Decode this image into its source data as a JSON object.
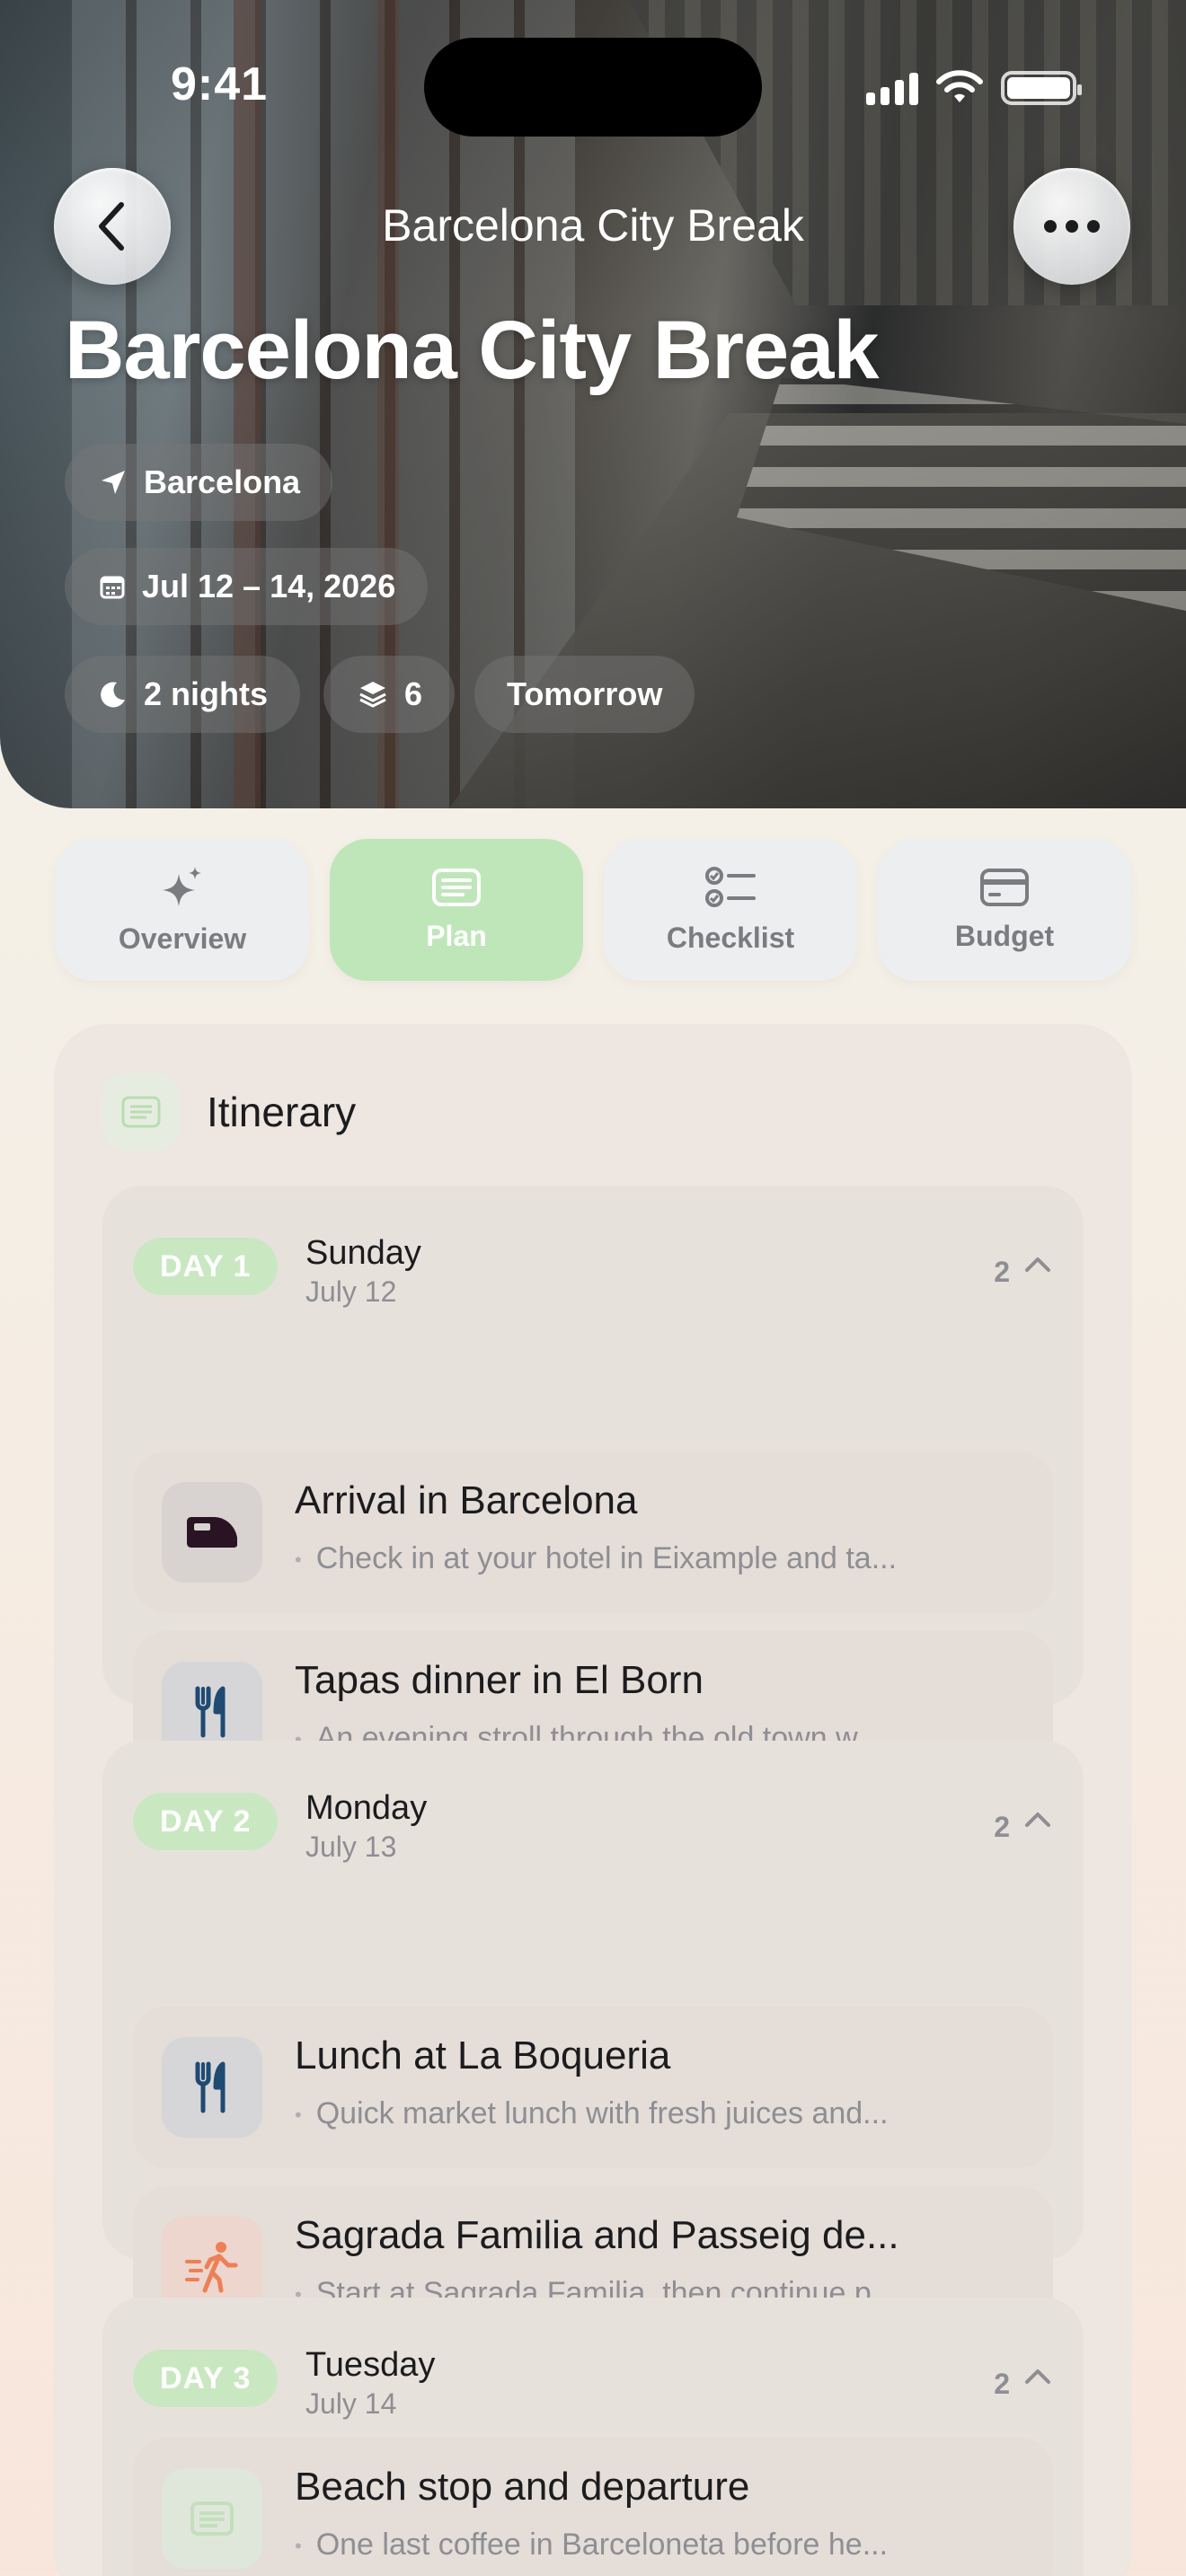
{
  "status_bar": {
    "time": "9:41"
  },
  "nav": {
    "title": "Barcelona City Break"
  },
  "hero": {
    "title": "Barcelona City Break",
    "location": "Barcelona",
    "dates": "Jul 12 – 14, 2026",
    "nights": "2 nights",
    "stops": "6",
    "when": "Tomorrow"
  },
  "tabs": [
    {
      "label": "Overview",
      "icon": "sparkles-icon",
      "active": false
    },
    {
      "label": "Plan",
      "icon": "list-card-icon",
      "active": true
    },
    {
      "label": "Checklist",
      "icon": "checklist-icon",
      "active": false
    },
    {
      "label": "Budget",
      "icon": "credit-card-icon",
      "active": false
    }
  ],
  "itinerary": {
    "title": "Itinerary",
    "days": [
      {
        "badge": "DAY 1",
        "weekday": "Sunday",
        "date": "July 12",
        "count": "2",
        "activities": [
          {
            "title": "Arrival in Barcelona",
            "desc": "Check in at your hotel in Eixample and ta...",
            "icon": "train-icon"
          },
          {
            "title": "Tapas dinner in El Born",
            "desc": "An evening stroll through the old town w...",
            "icon": "fork-knife-icon"
          }
        ]
      },
      {
        "badge": "DAY 2",
        "weekday": "Monday",
        "date": "July 13",
        "count": "2",
        "activities": [
          {
            "title": "Lunch at La Boqueria",
            "desc": "Quick market lunch with fresh juices and...",
            "icon": "fork-knife-icon"
          },
          {
            "title": "Sagrada Familia and Passeig de...",
            "desc": "Start at Sagrada Familia, then continue p...",
            "icon": "walking-icon"
          }
        ]
      },
      {
        "badge": "DAY 3",
        "weekday": "Tuesday",
        "date": "July 14",
        "count": "2",
        "activities": [
          {
            "title": "Beach stop and departure",
            "desc": "One last coffee in Barceloneta before he...",
            "icon": "note-icon"
          }
        ]
      }
    ]
  },
  "colors": {
    "accent_green": "#bfe6b9",
    "badge_green": "#c9e8c1",
    "icon_navy": "#1f4a72",
    "icon_orange": "#ee7f56",
    "train_dark": "#2a1424"
  }
}
